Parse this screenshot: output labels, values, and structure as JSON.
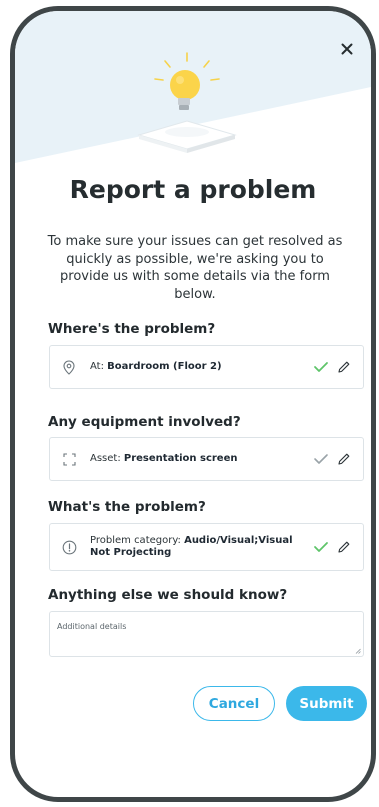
{
  "modal": {
    "title": "Report a problem",
    "description": "To make sure your issues can get resolved as quickly as possible, we're asking you to provide us with some details via the form below."
  },
  "sections": {
    "location": {
      "label": "Where's the problem?",
      "prefix": "At: ",
      "value": "Boardroom (Floor 2)",
      "icon": "location-pin-icon",
      "confirmed": true
    },
    "equipment": {
      "label": "Any equipment involved?",
      "prefix": "Asset: ",
      "value": "Presentation screen",
      "icon": "asset-frame-icon",
      "confirmed": false
    },
    "problem": {
      "label": "What's the problem?",
      "prefix": "Problem category: ",
      "value": "Audio/Visual;Visual Not Projecting",
      "icon": "alert-icon",
      "confirmed": true
    },
    "details": {
      "label": "Anything else we should know?",
      "placeholder": "Additional details"
    }
  },
  "buttons": {
    "cancel": "Cancel",
    "submit": "Submit"
  },
  "colors": {
    "accent": "#3bb8ea",
    "check_confirmed": "#5ec46a",
    "check_pending": "#9aa3a8",
    "hero_bg": "#e8f2f8"
  }
}
